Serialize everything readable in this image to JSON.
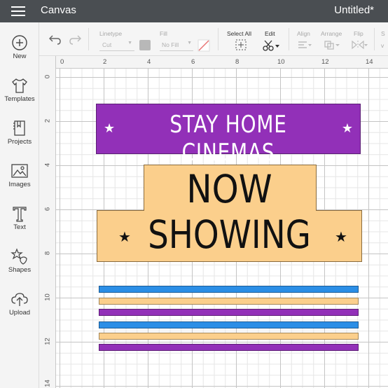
{
  "app": {
    "title": "Canvas",
    "document": "Untitled*"
  },
  "sidebar": {
    "items": [
      {
        "label": "New",
        "icon": "plus-circle-icon"
      },
      {
        "label": "Templates",
        "icon": "tshirt-icon"
      },
      {
        "label": "Projects",
        "icon": "bookmark-icon"
      },
      {
        "label": "Images",
        "icon": "image-icon"
      },
      {
        "label": "Text",
        "icon": "text-t-icon"
      },
      {
        "label": "Shapes",
        "icon": "shapes-icon"
      },
      {
        "label": "Upload",
        "icon": "cloud-upload-icon"
      }
    ]
  },
  "toolbar": {
    "linetype_label": "Linetype",
    "linetype_value": "Cut",
    "fill_label": "Fill",
    "fill_value": "No Fill",
    "select_all_label": "Select All",
    "edit_label": "Edit",
    "align_label": "Align",
    "arrange_label": "Arrange",
    "flip_label": "Flip",
    "size_label": "S"
  },
  "rulers": {
    "top": [
      "0",
      "2",
      "4",
      "6",
      "8",
      "10",
      "12",
      "14"
    ],
    "left": [
      "0",
      "2",
      "4",
      "6",
      "8",
      "10",
      "12",
      "14"
    ]
  },
  "design": {
    "banner_text": "STAY HOME CINEMAS",
    "marquee_line1": "NOW",
    "marquee_line2": "SHOWING",
    "colors": {
      "purple": "#9230b8",
      "orange": "#fbcf8c",
      "blue": "#2b8ee6"
    },
    "stripes": [
      "blue",
      "orange",
      "purple",
      "blue",
      "orange",
      "purple"
    ]
  }
}
